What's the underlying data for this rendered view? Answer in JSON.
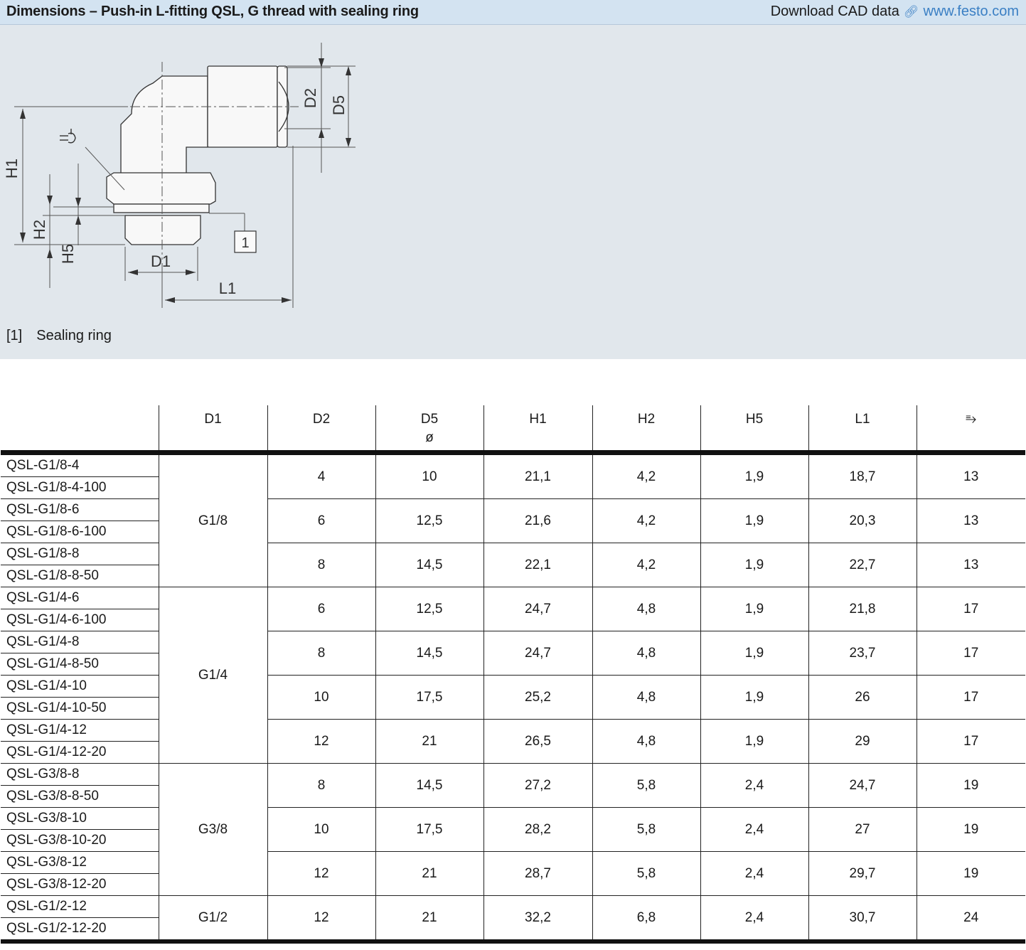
{
  "header": {
    "title": "Dimensions – Push-in L-fitting QSL, G thread with sealing ring",
    "cad_label": "Download CAD data",
    "link_icon": "link-icon",
    "url": "www.festo.com"
  },
  "drawing": {
    "labels": {
      "d2": "D2",
      "d5": "D5",
      "h1": "H1",
      "h2": "H2",
      "h5": "H5",
      "d1": "D1",
      "l1": "L1",
      "callout": "1"
    },
    "wrench_icon": "wrench-icon"
  },
  "legend": {
    "ref": "[1]",
    "text": "Sealing ring"
  },
  "table": {
    "headers": [
      "",
      "D1",
      "D2",
      "D5",
      "H1",
      "H2",
      "H5",
      "L1",
      "⥱"
    ],
    "d5_sub": "ø",
    "rows": [
      [
        "QSL-G1/8-4",
        "G1/8",
        "4",
        "10",
        "21,1",
        "4,2",
        "1,9",
        "18,7",
        "13"
      ],
      [
        "QSL-G1/8-4-100"
      ],
      [
        "QSL-G1/8-6",
        "6",
        "12,5",
        "21,6",
        "4,2",
        "1,9",
        "20,3",
        "13"
      ],
      [
        "QSL-G1/8-6-100"
      ],
      [
        "QSL-G1/8-8",
        "8",
        "14,5",
        "22,1",
        "4,2",
        "1,9",
        "22,7",
        "13"
      ],
      [
        "QSL-G1/8-8-50"
      ],
      [
        "QSL-G1/4-6",
        "G1/4",
        "6",
        "12,5",
        "24,7",
        "4,8",
        "1,9",
        "21,8",
        "17"
      ],
      [
        "QSL-G1/4-6-100"
      ],
      [
        "QSL-G1/4-8",
        "8",
        "14,5",
        "24,7",
        "4,8",
        "1,9",
        "23,7",
        "17"
      ],
      [
        "QSL-G1/4-8-50"
      ],
      [
        "QSL-G1/4-10",
        "10",
        "17,5",
        "25,2",
        "4,8",
        "1,9",
        "26",
        "17"
      ],
      [
        "QSL-G1/4-10-50"
      ],
      [
        "QSL-G1/4-12",
        "12",
        "21",
        "26,5",
        "4,8",
        "1,9",
        "29",
        "17"
      ],
      [
        "QSL-G1/4-12-20"
      ],
      [
        "QSL-G3/8-8",
        "G3/8",
        "8",
        "14,5",
        "27,2",
        "5,8",
        "2,4",
        "24,7",
        "19"
      ],
      [
        "QSL-G3/8-8-50"
      ],
      [
        "QSL-G3/8-10",
        "10",
        "17,5",
        "28,2",
        "5,8",
        "2,4",
        "27",
        "19"
      ],
      [
        "QSL-G3/8-10-20"
      ],
      [
        "QSL-G3/8-12",
        "12",
        "21",
        "28,7",
        "5,8",
        "2,4",
        "29,7",
        "19"
      ],
      [
        "QSL-G3/8-12-20"
      ],
      [
        "QSL-G1/2-12",
        "G1/2",
        "12",
        "21",
        "32,2",
        "6,8",
        "2,4",
        "30,7",
        "24"
      ],
      [
        "QSL-G1/2-12-20"
      ]
    ]
  }
}
